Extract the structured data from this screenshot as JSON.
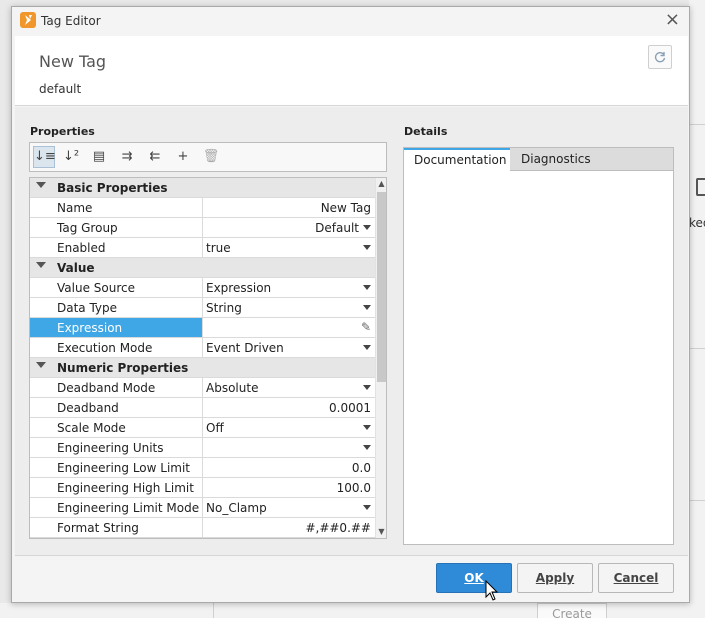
{
  "window": {
    "title": "Tag Editor",
    "app_icon": "ignition-icon",
    "close_glyph": "×"
  },
  "header": {
    "tag_name": "New Tag",
    "provider": "default"
  },
  "properties": {
    "label": "Properties",
    "toolbar": [
      {
        "name": "sort-categorized-icon",
        "glyph": "↓≡",
        "active": true
      },
      {
        "name": "sort-alphabetical-icon",
        "glyph": "↓²",
        "active": false
      },
      {
        "name": "show-details-icon",
        "glyph": "▤",
        "active": false
      },
      {
        "name": "expand-all-icon",
        "glyph": "⇉",
        "active": false
      },
      {
        "name": "collapse-all-icon",
        "glyph": "⇇",
        "active": false
      },
      {
        "name": "add-property-icon",
        "glyph": "+",
        "active": false
      },
      {
        "name": "delete-property-icon",
        "glyph": "🗑",
        "active": false,
        "disabled": true
      }
    ],
    "groups": [
      {
        "label": "Basic Properties",
        "rows": [
          {
            "name": "Name",
            "value": "New Tag",
            "align": "right",
            "dropdown": false
          },
          {
            "name": "Tag Group",
            "value": "Default",
            "align": "right",
            "dropdown": true
          },
          {
            "name": "Enabled",
            "value": "true",
            "align": "left",
            "dropdown": true
          }
        ]
      },
      {
        "label": "Value",
        "rows": [
          {
            "name": "Value Source",
            "value": "Expression",
            "align": "left",
            "dropdown": true
          },
          {
            "name": "Data Type",
            "value": "String",
            "align": "left",
            "dropdown": true
          },
          {
            "name": "Expression",
            "value": "",
            "align": "left",
            "dropdown": false,
            "selected": true,
            "editor": true
          },
          {
            "name": "Execution Mode",
            "value": "Event Driven",
            "align": "left",
            "dropdown": true
          }
        ]
      },
      {
        "label": "Numeric Properties",
        "rows": [
          {
            "name": "Deadband Mode",
            "value": "Absolute",
            "align": "left",
            "dropdown": true
          },
          {
            "name": "Deadband",
            "value": "0.0001",
            "align": "right",
            "dropdown": false
          },
          {
            "name": "Scale Mode",
            "value": "Off",
            "align": "left",
            "dropdown": true
          },
          {
            "name": "Engineering Units",
            "value": "",
            "align": "left",
            "dropdown": true
          },
          {
            "name": "Engineering Low Limit",
            "value": "0.0",
            "align": "right",
            "dropdown": false
          },
          {
            "name": "Engineering High Limit",
            "value": "100.0",
            "align": "right",
            "dropdown": false
          },
          {
            "name": "Engineering Limit Mode",
            "value": "No_Clamp",
            "align": "left",
            "dropdown": true
          },
          {
            "name": "Format String",
            "value": "#,##0.##",
            "align": "right",
            "dropdown": false
          }
        ]
      }
    ]
  },
  "details": {
    "label": "Details",
    "tabs": [
      {
        "label": "Documentation",
        "active": true
      },
      {
        "label": "Diagnostics",
        "active": false
      }
    ]
  },
  "buttons": {
    "ok": "OK",
    "apply": "Apply",
    "cancel": "Cancel"
  },
  "background": {
    "partial_text": "ked",
    "create_button": "Create"
  },
  "colors": {
    "accent": "#3fa7e6",
    "primary_button": "#2f8ad8",
    "app_icon": "#f0962a"
  }
}
